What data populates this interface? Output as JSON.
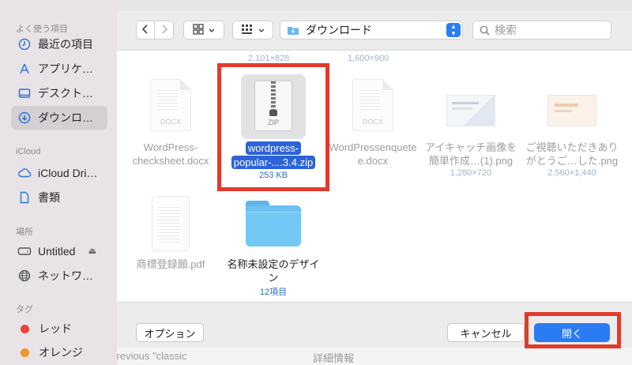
{
  "background": {
    "bottom_text": "Enables the previous \"classic",
    "bottom_link": "詳細情報"
  },
  "sidebar": {
    "favorites_header": "よく使う項目",
    "favorites": [
      {
        "label": "最近の項目",
        "icon": "clock-icon"
      },
      {
        "label": "アプリケ…",
        "icon": "applications-icon"
      },
      {
        "label": "デスクト…",
        "icon": "desktop-icon"
      },
      {
        "label": "ダウンロ…",
        "icon": "download-icon",
        "selected": true
      }
    ],
    "icloud_header": "iCloud",
    "icloud": [
      {
        "label": "iCloud Dri…",
        "icon": "cloud-icon"
      },
      {
        "label": "書類",
        "icon": "document-icon"
      }
    ],
    "locations_header": "場所",
    "locations": [
      {
        "label": "Untitled",
        "icon": "drive-icon"
      },
      {
        "label": "ネットワ…",
        "icon": "globe-icon"
      }
    ],
    "tags_header": "タグ",
    "tags": [
      {
        "label": "レッド",
        "color": "#e8433a"
      },
      {
        "label": "オレンジ",
        "color": "#f0962b"
      }
    ]
  },
  "toolbar": {
    "back_icon": "chevron-left-icon",
    "forward_icon": "chevron-right-icon",
    "location": "ダウンロード",
    "search_placeholder": "検索"
  },
  "files": {
    "top_dims": [
      "2,101×828",
      "1,600×900"
    ],
    "row1": [
      {
        "name_line1": "WordPress-",
        "name_line2": "checksheet.docx",
        "kind": "docx",
        "ext": "DOCX"
      },
      {
        "name_line1": "wordpress-",
        "name_line2": "popular-....3.4.zip",
        "meta": "253 KB",
        "kind": "zip",
        "ext": "ZIP",
        "selected": true
      },
      {
        "name_line1": "WordPressenquete",
        "name_line2": "e.docx",
        "kind": "docx",
        "ext": "DOCX"
      },
      {
        "name_line1": "アイキャッチ画像を",
        "name_line2": "簡単作成…(1).png",
        "meta": "1,280×720",
        "kind": "image"
      },
      {
        "name_line1": "ご視聴いただきあり",
        "name_line2": "がとうご…した.png",
        "meta": "2,560×1,440",
        "kind": "image"
      }
    ],
    "row2": [
      {
        "name_line1": "商標登録願.pdf",
        "kind": "pdf"
      },
      {
        "name_line1": "名称未設定のデザイ",
        "name_line2": "ン",
        "meta": "12項目",
        "kind": "folder"
      }
    ]
  },
  "footer": {
    "options_label": "オプション",
    "cancel_label": "キャンセル",
    "open_label": "開く"
  },
  "colors": {
    "accent": "#2a7cf3",
    "highlight": "#e23a2b",
    "selection": "#2d63d8"
  }
}
